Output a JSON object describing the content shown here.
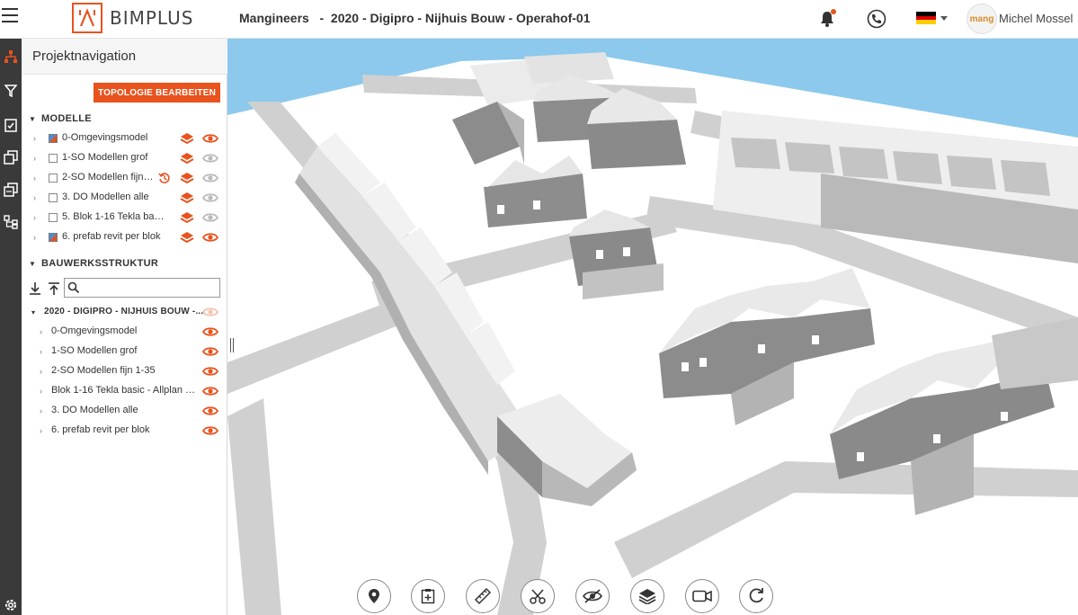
{
  "app": {
    "logo_text": "BIMPLUS",
    "project_title": "Mangineers   -  2020 - Digipro - Nijhuis Bouw - Operahof-01",
    "user_name": "Michel Mossel",
    "avatar_text": "mang"
  },
  "colors": {
    "accent": "#e8531e",
    "rail": "#3a3a3a",
    "sky": "#8cc9ec"
  },
  "panel": {
    "title": "Projektnavigation",
    "topology_button": "TOPOLOGIE BEARBEITEN",
    "models_section": "MODELLE",
    "models": [
      {
        "label": "0-Omgevingsmodel",
        "checked": true,
        "layers_active": true,
        "visible": true
      },
      {
        "label": "1-SO Modellen grof",
        "checked": false,
        "layers_active": true,
        "visible": false
      },
      {
        "label": "2-SO Modellen fijn 1...",
        "checked": false,
        "layers_active": true,
        "visible": false,
        "history": true
      },
      {
        "label": "3. DO Modellen alle",
        "checked": false,
        "layers_active": true,
        "visible": false
      },
      {
        "label": "5. Blok 1-16 Tekla basic - ...",
        "checked": false,
        "layers_active": true,
        "visible": false
      },
      {
        "label": "6. prefab revit per blok",
        "checked": true,
        "layers_active": true,
        "visible": true
      }
    ],
    "structure_section": "BAUWERKSSTRUKTUR",
    "search_placeholder": "",
    "root_label": "2020 - DIGIPRO - NIJHUIS BOUW -...",
    "structure": [
      {
        "label": "0-Omgevingsmodel"
      },
      {
        "label": "1-SO Modellen grof"
      },
      {
        "label": "2-SO Modellen fijn 1-35"
      },
      {
        "label": "Blok 1-16 Tekla basic - Allplan exp..."
      },
      {
        "label": "3. DO Modellen alle"
      },
      {
        "label": "6. prefab revit per blok"
      }
    ]
  },
  "rail_icons": [
    "structure-icon",
    "filter-icon",
    "clipboard-check-icon",
    "copy-icon",
    "copy-alt-icon",
    "hierarchy-icon",
    "settings-icon"
  ],
  "bottom_toolbar": [
    "location-pin-icon",
    "clipboard-add-icon",
    "ruler-icon",
    "scissors-icon",
    "eye-off-icon",
    "layers-icon",
    "video-camera-icon",
    "rotate-icon"
  ]
}
